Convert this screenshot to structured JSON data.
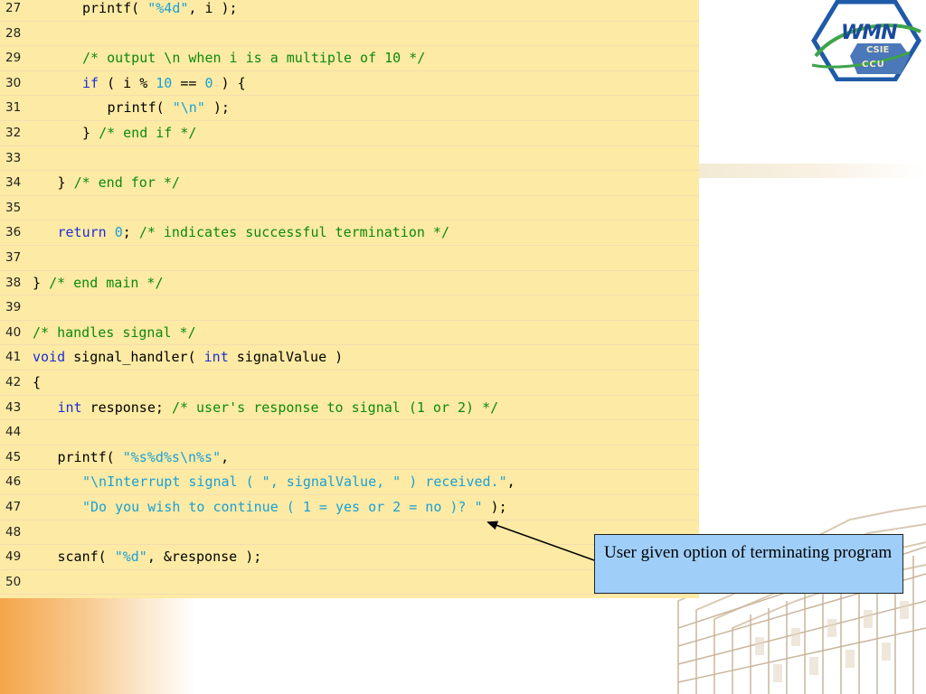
{
  "code": {
    "lines": [
      {
        "n": "27",
        "indent": 2,
        "tokens": [
          [
            "p",
            "printf( "
          ],
          [
            "s",
            "\"%4d\""
          ],
          [
            "p",
            ", i );"
          ]
        ]
      },
      {
        "n": "28",
        "indent": 0,
        "tokens": []
      },
      {
        "n": "29",
        "indent": 2,
        "tokens": [
          [
            "c",
            "/* output \\n when i is a multiple of 10 */"
          ]
        ]
      },
      {
        "n": "30",
        "indent": 2,
        "tokens": [
          [
            "k",
            "if"
          ],
          [
            "p",
            " ( i % "
          ],
          [
            "n",
            "10"
          ],
          [
            "p",
            " == "
          ],
          [
            "n",
            "0"
          ],
          [
            "p",
            " ) {"
          ]
        ]
      },
      {
        "n": "31",
        "indent": 3,
        "tokens": [
          [
            "p",
            "printf( "
          ],
          [
            "s",
            "\"\\n\""
          ],
          [
            "p",
            " );"
          ]
        ]
      },
      {
        "n": "32",
        "indent": 2,
        "tokens": [
          [
            "p",
            "} "
          ],
          [
            "c",
            "/* end if */"
          ]
        ]
      },
      {
        "n": "33",
        "indent": 0,
        "tokens": []
      },
      {
        "n": "34",
        "indent": 1,
        "tokens": [
          [
            "p",
            "} "
          ],
          [
            "c",
            "/* end for */"
          ]
        ]
      },
      {
        "n": "35",
        "indent": 0,
        "tokens": []
      },
      {
        "n": "36",
        "indent": 1,
        "tokens": [
          [
            "k",
            "return"
          ],
          [
            "p",
            " "
          ],
          [
            "n",
            "0"
          ],
          [
            "p",
            "; "
          ],
          [
            "c",
            "/* indicates successful termination */"
          ]
        ]
      },
      {
        "n": "37",
        "indent": 0,
        "tokens": []
      },
      {
        "n": "38",
        "indent": 0,
        "tokens": [
          [
            "p",
            "} "
          ],
          [
            "c",
            "/* end main */"
          ]
        ]
      },
      {
        "n": "39",
        "indent": 0,
        "tokens": []
      },
      {
        "n": "40",
        "indent": 0,
        "tokens": [
          [
            "c",
            "/* handles signal */"
          ]
        ]
      },
      {
        "n": "41",
        "indent": 0,
        "tokens": [
          [
            "k",
            "void"
          ],
          [
            "p",
            " signal_handler( "
          ],
          [
            "k",
            "int"
          ],
          [
            "p",
            " signalValue )"
          ]
        ]
      },
      {
        "n": "42",
        "indent": 0,
        "tokens": [
          [
            "p",
            "{"
          ]
        ]
      },
      {
        "n": "43",
        "indent": 1,
        "tokens": [
          [
            "k",
            "int"
          ],
          [
            "p",
            " response; "
          ],
          [
            "c",
            "/* user's response to signal (1 or 2) */"
          ]
        ]
      },
      {
        "n": "44",
        "indent": 0,
        "tokens": []
      },
      {
        "n": "45",
        "indent": 1,
        "tokens": [
          [
            "p",
            "printf( "
          ],
          [
            "s",
            "\"%s%d%s\\n%s\""
          ],
          [
            "p",
            ","
          ]
        ]
      },
      {
        "n": "46",
        "indent": 2,
        "tokens": [
          [
            "s",
            "\"\\nInterrupt signal ( \", signalValue, \" ) received.\""
          ],
          [
            "p",
            ","
          ]
        ]
      },
      {
        "n": "47",
        "indent": 2,
        "tokens": [
          [
            "s",
            "\"Do you wish to continue ( 1 = yes or 2 = no )? \""
          ],
          [
            "p",
            " );"
          ]
        ]
      },
      {
        "n": "48",
        "indent": 0,
        "tokens": []
      },
      {
        "n": "49",
        "indent": 1,
        "tokens": [
          [
            "p",
            "scanf( "
          ],
          [
            "s",
            "\"%d\""
          ],
          [
            "p",
            ", &response );"
          ]
        ]
      },
      {
        "n": "50",
        "indent": 0,
        "tokens": []
      }
    ]
  },
  "callout": {
    "text": "User given option of terminating program"
  },
  "logo": {
    "title": "WMN",
    "line1": "CSIE",
    "line2": "CCU"
  },
  "colors": {
    "code_background": "#fdeaa4",
    "keyword": "#1a2fd6",
    "string": "#1aa0d6",
    "comment": "#0c8a0c",
    "callout_fill": "#9fcff9"
  }
}
